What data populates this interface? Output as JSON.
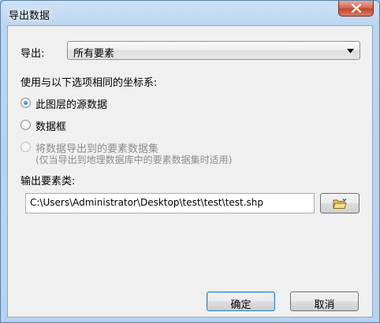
{
  "window": {
    "title": "导出数据"
  },
  "export": {
    "label": "导出:",
    "selected": "所有要素"
  },
  "coord": {
    "heading": "使用与以下选项相同的坐标系:",
    "options": [
      {
        "label": "此图层的源数据",
        "checked": true,
        "enabled": true
      },
      {
        "label": "数据框",
        "checked": false,
        "enabled": true
      },
      {
        "label": "将数据导出到的要素数据集",
        "note": "(仅当导出到地理数据库中的要素数据集时适用)",
        "checked": false,
        "enabled": false
      }
    ]
  },
  "output": {
    "label": "输出要素类:",
    "path": "C:\\Users\\Administrator\\Desktop\\test\\test\\test.shp"
  },
  "buttons": {
    "ok": "确定",
    "cancel": "取消"
  },
  "icons": {
    "close": "close-icon",
    "browse": "open-folder-icon",
    "dropdown": "chevron-down-icon"
  },
  "colors": {
    "close_button": "#c4462e",
    "title_bar": "#bcd6f1",
    "radio_selected": "#1a62b0"
  }
}
